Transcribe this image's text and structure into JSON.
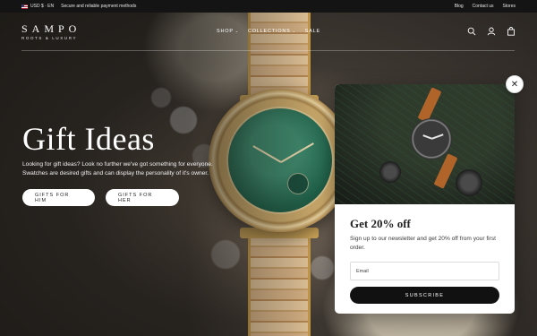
{
  "topbar": {
    "currency": "USD $ · EN",
    "message": "Secure and reliable payment methods",
    "links": [
      "Blog",
      "Contact us",
      "Stores"
    ]
  },
  "header": {
    "logo_name": "SAMPO",
    "logo_tagline": "ROOTS & LUXURY",
    "nav": [
      {
        "label": "SHOP",
        "has_dropdown": true
      },
      {
        "label": "COLLECTIONS",
        "has_dropdown": true
      },
      {
        "label": "SALE",
        "has_dropdown": false
      }
    ],
    "icons": [
      "search-icon",
      "account-icon",
      "cart-icon"
    ]
  },
  "hero": {
    "title": "Gift Ideas",
    "text": "Looking for gift ideas? Look no further we've got something for everyone. Swatches are desired gifts and can display the personality of it's owner.",
    "button_him": "GIFTS FOR HIM",
    "button_her": "GIFTS FOR HER"
  },
  "popup": {
    "title": "Get 20% off",
    "text": "Sign up to our newsletter and get 20% off from your first order.",
    "email_placeholder": "Email",
    "submit_label": "SUBSCRIBE",
    "close_icon": "close-icon"
  },
  "colors": {
    "topbar_bg": "#141414",
    "button_bg": "#ffffff",
    "submit_bg": "#111111"
  }
}
